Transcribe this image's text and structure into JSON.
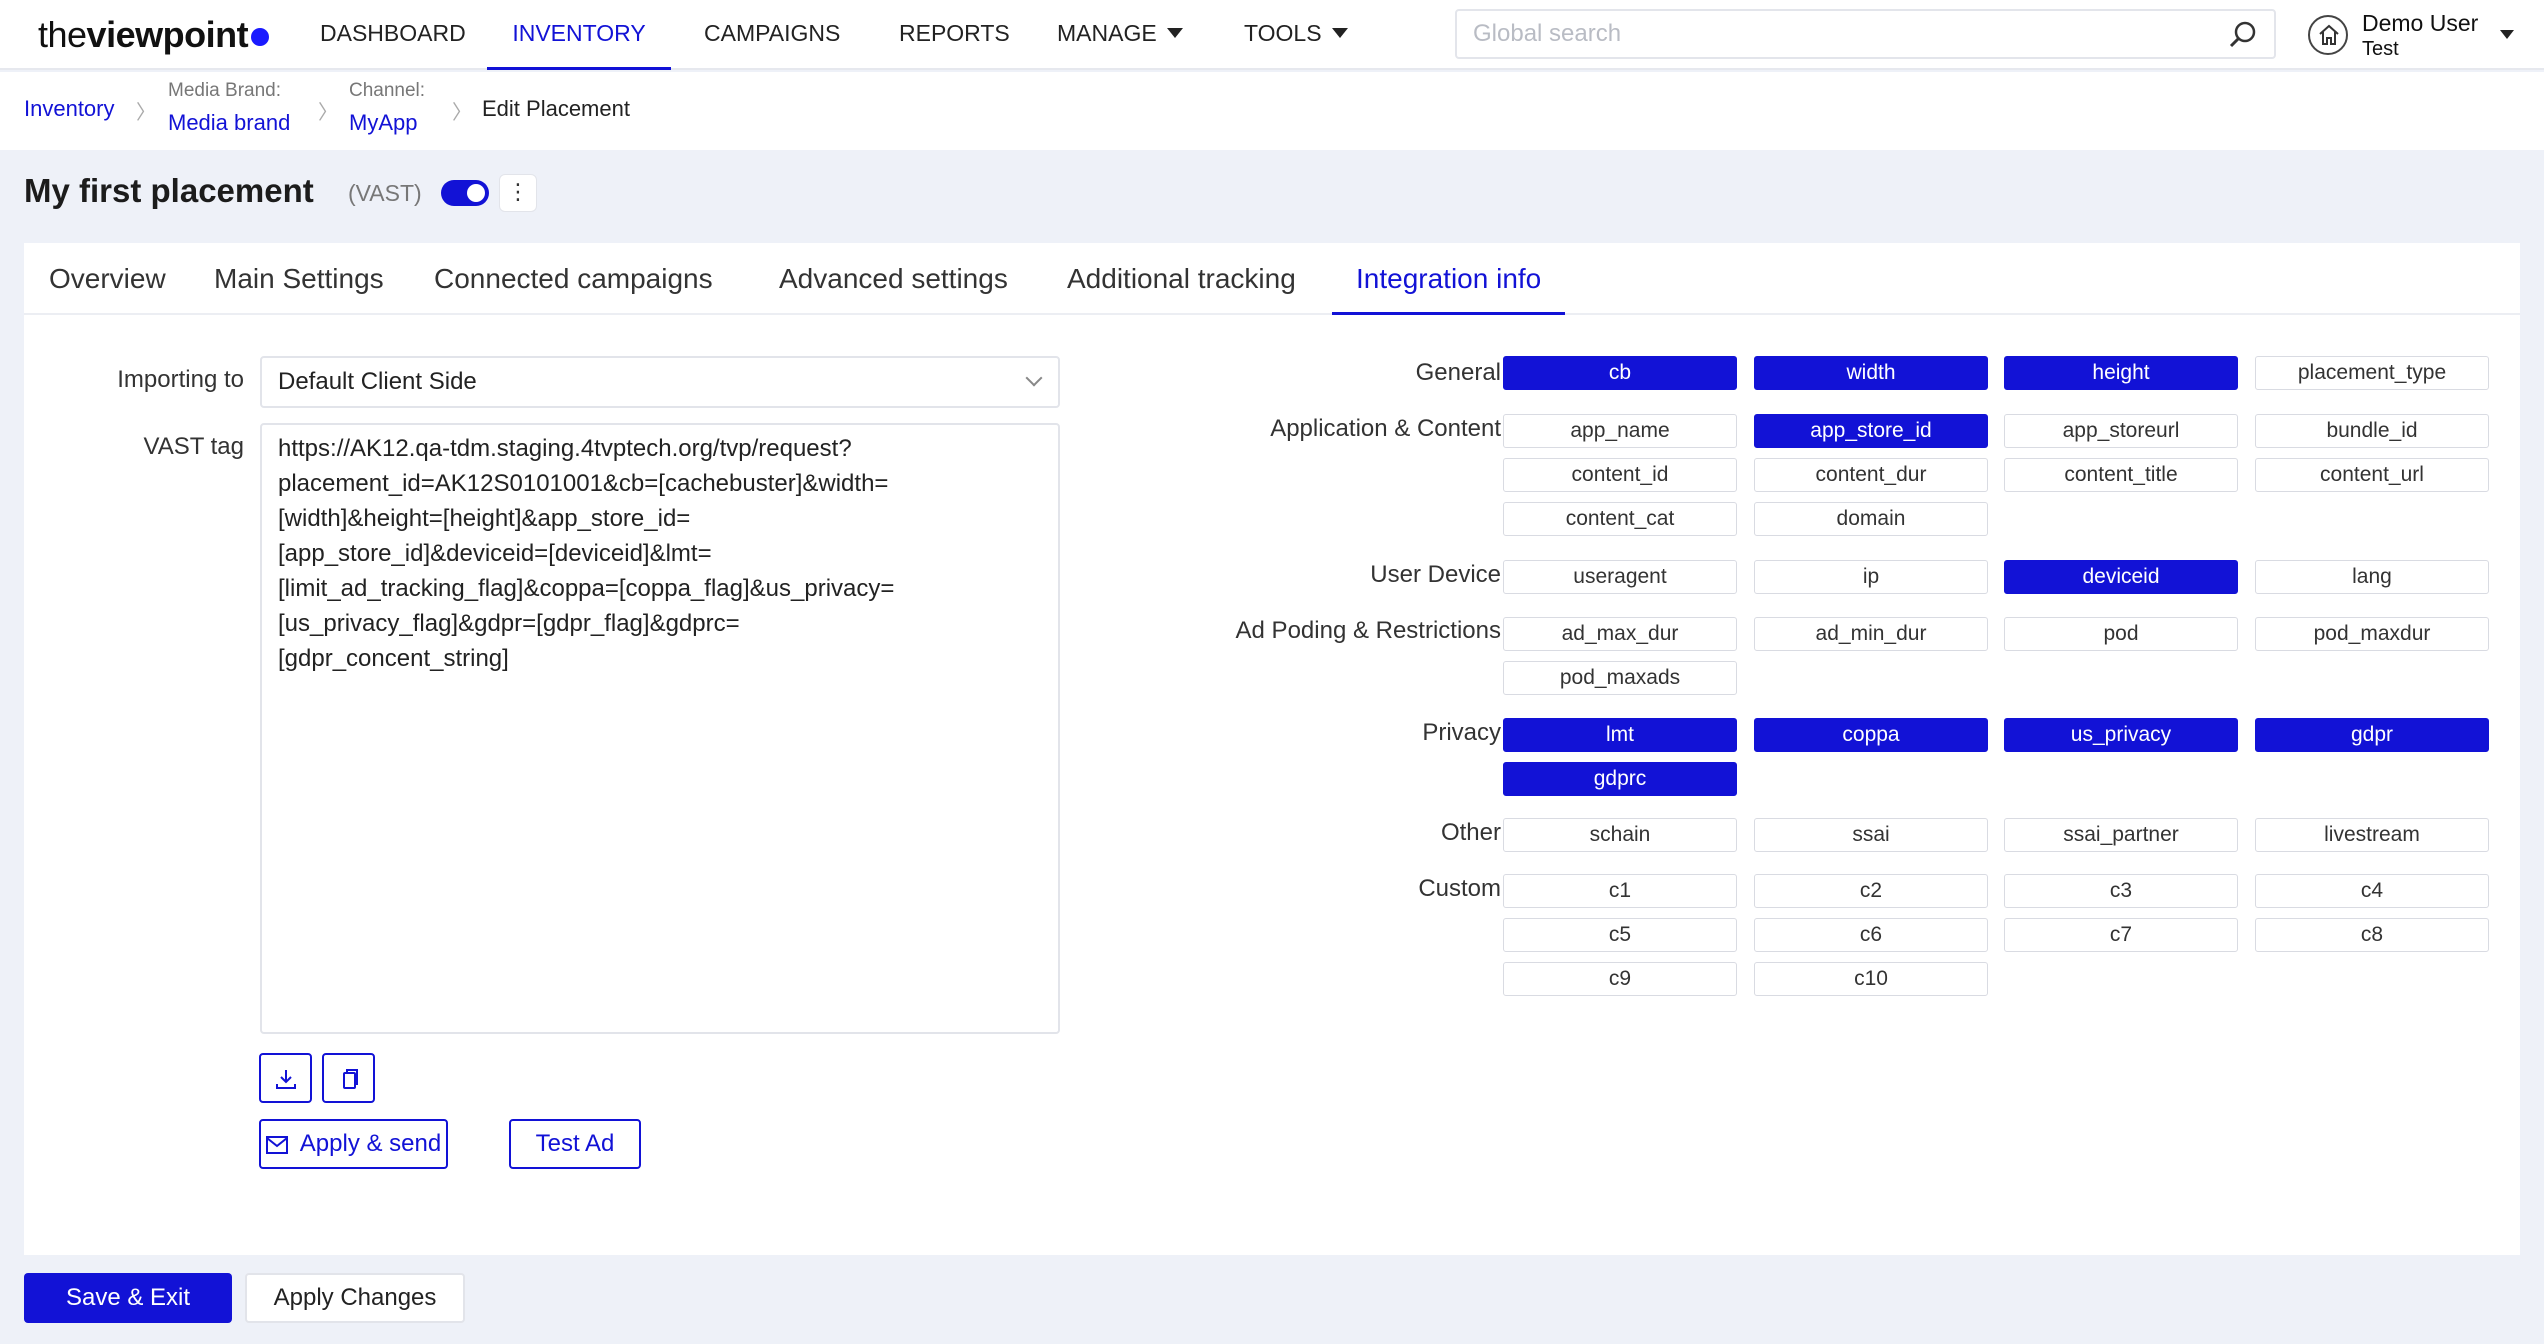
{
  "brand": {
    "light": "the",
    "bold": "viewpoint"
  },
  "nav": {
    "dashboard": "DASHBOARD",
    "inventory": "INVENTORY",
    "campaigns": "CAMPAIGNS",
    "reports": "REPORTS",
    "manage": "MANAGE",
    "tools": "TOOLS"
  },
  "search": {
    "placeholder": "Global search",
    "icon": "search-icon"
  },
  "user": {
    "name": "Demo User",
    "account": "Test",
    "icon": "home-icon"
  },
  "breadcrumb": {
    "inventory": "Inventory",
    "media_brand_caption": "Media Brand:",
    "media_brand": "Media brand",
    "channel_caption": "Channel:",
    "channel": "MyApp",
    "current": "Edit Placement",
    "separator": "〉"
  },
  "placement": {
    "title": "My first placement",
    "type": "(VAST)",
    "enabled": true,
    "menu_icon": "⋮"
  },
  "tabs": {
    "overview": "Overview",
    "main_settings": "Main Settings",
    "connected_campaigns": "Connected campaigns",
    "advanced_settings": "Advanced settings",
    "additional_tracking": "Additional tracking",
    "integration_info": "Integration info"
  },
  "form": {
    "importing_label": "Importing to",
    "importing_value": "Default Client Side",
    "vast_label": "VAST tag",
    "vast_lines": [
      "https://AK12.qa-tdm.staging.4tvptech.org/tvp/request?",
      "placement_id=AK12S0101001&cb=[cachebuster]&width=",
      "[width]&height=[height]&app_store_id=",
      "[app_store_id]&deviceid=[deviceid]&lmt=",
      "[limit_ad_tracking_flag]&coppa=[coppa_flag]&us_privacy=",
      "[us_privacy_flag]&gdpr=[gdpr_flag]&gdprc=",
      "[gdpr_concent_string]"
    ],
    "apply_send": "Apply & send",
    "test_ad": "Test Ad",
    "download_icon": "download-icon",
    "copy_icon": "copy-icon",
    "mail_icon": "mail-icon"
  },
  "params": {
    "general": {
      "label": "General",
      "chips": [
        "cb",
        "width",
        "height",
        "placement_type"
      ]
    },
    "application": {
      "label": "Application & Content",
      "chips": [
        "app_name",
        "app_store_id",
        "app_storeurl",
        "bundle_id",
        "content_id",
        "content_dur",
        "content_title",
        "content_url",
        "content_cat",
        "domain"
      ]
    },
    "device": {
      "label": "User Device",
      "chips": [
        "useragent",
        "ip",
        "deviceid",
        "lang"
      ]
    },
    "adpod": {
      "label": "Ad Poding & Restrictions",
      "chips": [
        "ad_max_dur",
        "ad_min_dur",
        "pod",
        "pod_maxdur",
        "pod_maxads"
      ]
    },
    "privacy": {
      "label": "Privacy",
      "chips": [
        "lmt",
        "coppa",
        "us_privacy",
        "gdpr",
        "gdprc"
      ]
    },
    "other": {
      "label": "Other",
      "chips": [
        "schain",
        "ssai",
        "ssai_partner",
        "livestream"
      ]
    },
    "custom": {
      "label": "Custom",
      "chips": [
        "c1",
        "c2",
        "c3",
        "c4",
        "c5",
        "c6",
        "c7",
        "c8",
        "c9",
        "c10"
      ]
    },
    "selected": [
      "cb",
      "width",
      "height",
      "app_store_id",
      "deviceid",
      "lmt",
      "coppa",
      "us_privacy",
      "gdpr",
      "gdprc"
    ]
  },
  "footer": {
    "save_exit": "Save & Exit",
    "apply_changes": "Apply Changes"
  },
  "colors": {
    "accent": "#1212d6",
    "background": "#eef1f8"
  }
}
